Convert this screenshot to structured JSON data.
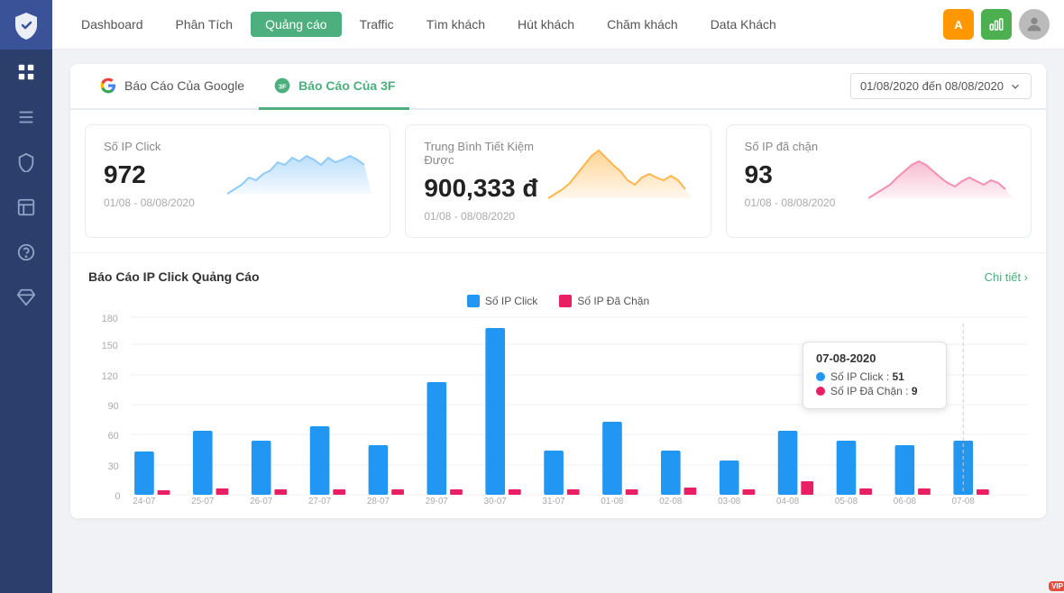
{
  "sidebar": {
    "items": [
      {
        "name": "logo",
        "icon": "shield"
      },
      {
        "name": "dashboard",
        "icon": "grid"
      },
      {
        "name": "list",
        "icon": "list"
      },
      {
        "name": "shield",
        "icon": "shield-check"
      },
      {
        "name": "layout",
        "icon": "layout"
      },
      {
        "name": "help",
        "icon": "help-circle"
      },
      {
        "name": "gem",
        "icon": "gem"
      }
    ]
  },
  "topnav": {
    "items": [
      {
        "label": "Dashboard",
        "active": false
      },
      {
        "label": "Phân Tích",
        "active": false
      },
      {
        "label": "Quảng cáo",
        "active": true
      },
      {
        "label": "Traffic",
        "active": false
      },
      {
        "label": "Tìm khách",
        "active": false
      },
      {
        "label": "Hút khách",
        "active": false
      },
      {
        "label": "Chăm khách",
        "active": false
      },
      {
        "label": "Data Khách",
        "active": false
      }
    ],
    "icons": {
      "notification": "A",
      "chart": "📊"
    }
  },
  "tabs": [
    {
      "label": "Báo Cáo Của Google",
      "icon": "google",
      "active": false
    },
    {
      "label": "Báo Cáo Của 3F",
      "icon": "3f",
      "active": true
    }
  ],
  "date_filter": {
    "value": "01/08/2020 đến 08/08/2020"
  },
  "stats": [
    {
      "title": "Số IP Click",
      "value": "972",
      "date": "01/08 - 08/08/2020",
      "color": "#90caf9",
      "chart_data": [
        30,
        40,
        35,
        55,
        50,
        60,
        65,
        80,
        95,
        70,
        60,
        45,
        50,
        60,
        40,
        30,
        45,
        60,
        70,
        80
      ]
    },
    {
      "title": "Trung Bình Tiết Kiệm Được",
      "value": "900,333 đ",
      "date": "01/08 - 08/08/2020",
      "color": "#ffb74d",
      "chart_data": [
        20,
        25,
        30,
        50,
        65,
        80,
        90,
        100,
        85,
        70,
        55,
        40,
        35,
        45,
        50,
        55,
        45,
        35,
        30,
        25
      ]
    },
    {
      "title": "Số IP đã chặn",
      "value": "93",
      "date": "01/08 - 08/08/2020",
      "color": "#f48fb1",
      "chart_data": [
        15,
        20,
        25,
        35,
        45,
        55,
        65,
        70,
        60,
        50,
        45,
        35,
        30,
        35,
        40,
        45,
        40,
        35,
        30,
        25
      ]
    }
  ],
  "chart": {
    "title": "Báo Cáo IP Click Quảng Cáo",
    "detail_label": "Chi tiết ›",
    "legend": [
      {
        "label": "Số IP Click",
        "color": "#2196f3"
      },
      {
        "label": "Số IP Đã Chặn",
        "color": "#e91e63"
      }
    ],
    "y_labels": [
      0,
      30,
      60,
      90,
      120,
      150,
      180
    ],
    "x_labels": [
      "24-07",
      "25-07",
      "26-07",
      "27-07",
      "28-07",
      "29-07",
      "30-07",
      "31-07",
      "01-08",
      "02-08",
      "03-08",
      "04-08",
      "05-08",
      "06-08",
      "07-08"
    ],
    "bars_click": [
      45,
      65,
      55,
      70,
      50,
      115,
      170,
      45,
      75,
      45,
      35,
      65,
      55,
      50,
      55
    ],
    "bars_blocked": [
      4,
      3,
      5,
      3,
      4,
      5,
      3,
      4,
      4,
      6,
      5,
      14,
      4,
      5,
      4
    ],
    "tooltip": {
      "date": "07-08-2020",
      "click_label": "Số IP Click",
      "click_value": "51",
      "blocked_label": "Số IP Đã Chặn",
      "blocked_value": "9",
      "click_color": "#2196f3",
      "blocked_color": "#e91e63"
    }
  }
}
